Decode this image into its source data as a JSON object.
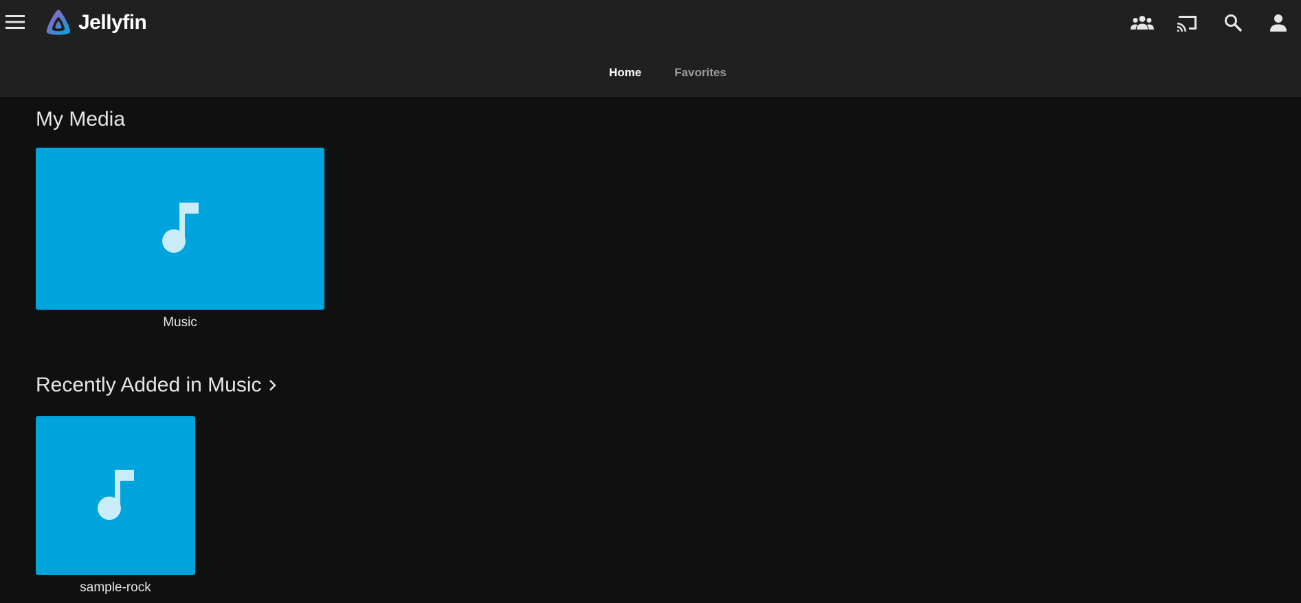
{
  "app": {
    "name": "Jellyfin",
    "accent_color": "#00a4dc",
    "header_color": "#202020",
    "background_color": "#101010"
  },
  "header": {
    "menu_icon": "hamburger-menu-icon",
    "right_icons": [
      "group-icon",
      "cast-icon",
      "search-icon",
      "user-icon"
    ]
  },
  "tabs": [
    {
      "label": "Home",
      "active": true
    },
    {
      "label": "Favorites",
      "active": false
    }
  ],
  "sections": {
    "my_media": {
      "title": "My Media",
      "items": [
        {
          "label": "Music",
          "icon": "music-note-icon"
        }
      ]
    },
    "recently_added": {
      "title": "Recently Added in Music",
      "items": [
        {
          "label": "sample-rock",
          "icon": "music-note-icon"
        }
      ]
    }
  }
}
